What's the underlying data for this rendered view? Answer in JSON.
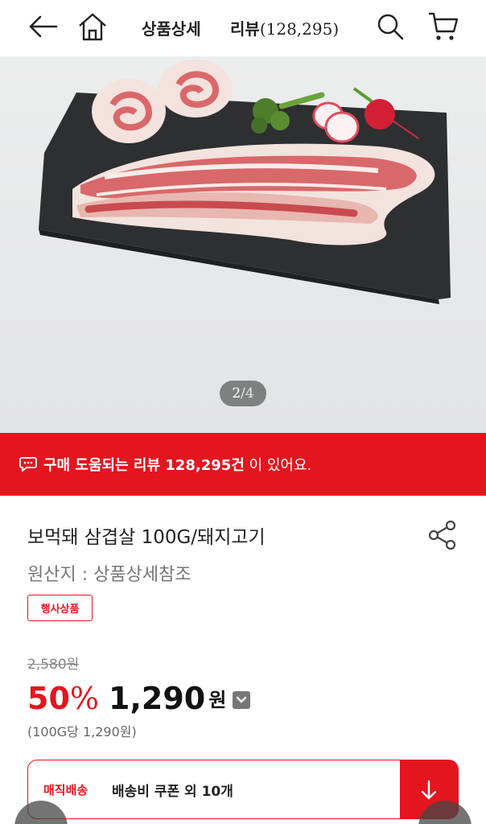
{
  "header": {
    "tab_detail": "상품상세",
    "tab_review_label": "리뷰",
    "tab_review_count": "(128,295)"
  },
  "icons": {
    "back": "back-arrow-icon",
    "home": "home-icon",
    "search": "search-icon",
    "cart": "cart-icon",
    "share": "share-icon",
    "chat": "chat-bubble-icon",
    "download": "arrow-down-icon"
  },
  "gallery": {
    "current": "2",
    "total": "/4"
  },
  "review_banner": {
    "strong_text": "구매 도움되는 리뷰 128,295건",
    "rest_text": " 이 있어요."
  },
  "product": {
    "title": "보먹돼 삼겹살 100G/돼지고기",
    "origin": "원산지 : 상품상세참조",
    "badge": "행사상품",
    "original_price": "2,580원",
    "discount_num": "50",
    "discount_pct": "%",
    "price": "1,290",
    "currency": "원",
    "unit_price": "(100G당 1,290원)"
  },
  "delivery": {
    "label": "매직배송",
    "text": "배송비 쿠폰 외 10개"
  },
  "colors": {
    "accent": "#e4151f",
    "text": "#222222",
    "muted": "#777777"
  }
}
